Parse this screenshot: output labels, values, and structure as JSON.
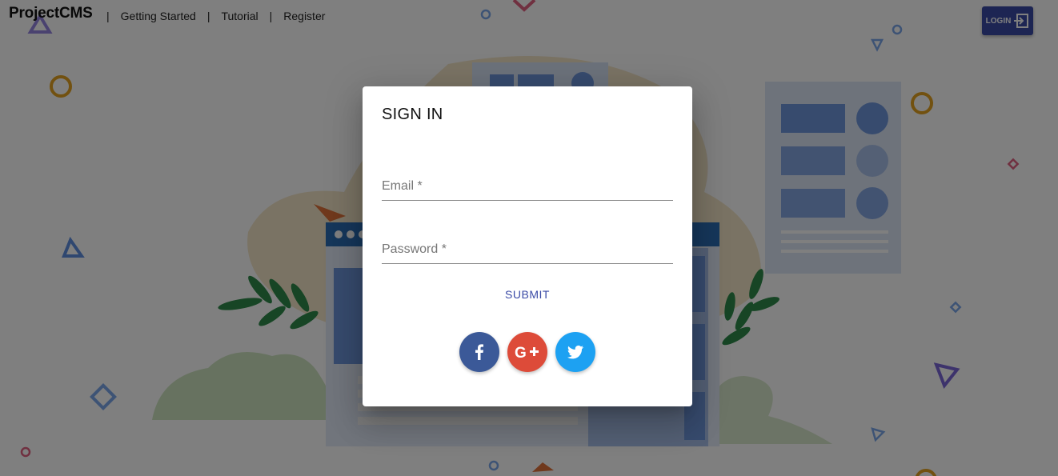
{
  "header": {
    "brand": "ProjectCMS",
    "separator": "|",
    "nav": [
      {
        "label": "Getting Started"
      },
      {
        "label": "Tutorial"
      },
      {
        "label": "Register"
      }
    ],
    "login_label": "LOGIN"
  },
  "dialog": {
    "title": "SIGN IN",
    "email_label": "Email *",
    "password_label": "Password *",
    "submit_label": "SUBMIT",
    "social_icons": [
      "facebook-icon",
      "google-plus-icon",
      "twitter-icon"
    ]
  },
  "colors": {
    "accent": "#3a4aa6",
    "facebook": "#3b5998",
    "google_plus": "#dd4b39",
    "twitter": "#1da1f2"
  }
}
